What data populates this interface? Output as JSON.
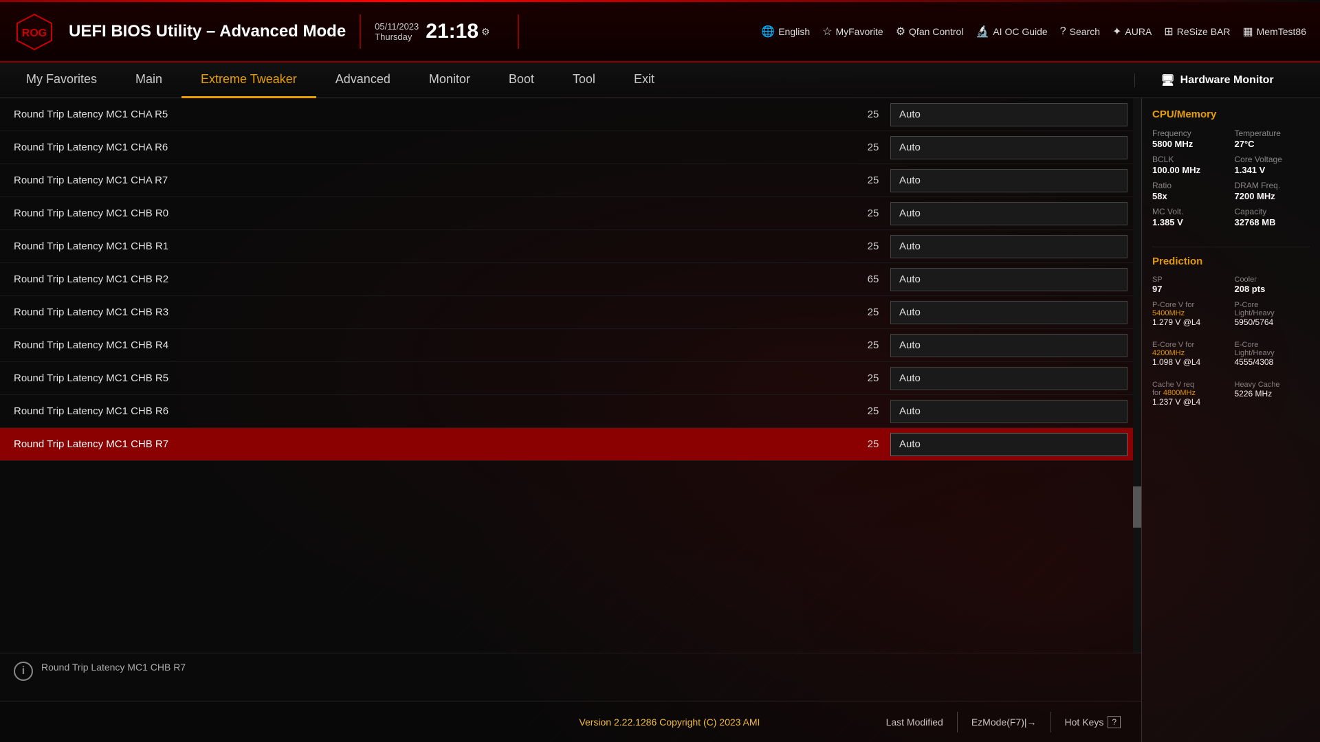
{
  "header": {
    "title": "UEFI BIOS Utility – Advanced Mode",
    "date": "05/11/2023",
    "day": "Thursday",
    "time": "21:18",
    "tools": [
      {
        "id": "english",
        "label": "English",
        "icon": "🌐"
      },
      {
        "id": "myfavorite",
        "label": "MyFavorite",
        "icon": "☆"
      },
      {
        "id": "qfan",
        "label": "Qfan Control",
        "icon": "⚙"
      },
      {
        "id": "aioc",
        "label": "AI OC Guide",
        "icon": "🔬"
      },
      {
        "id": "search",
        "label": "Search",
        "icon": "?"
      },
      {
        "id": "aura",
        "label": "AURA",
        "icon": "✦"
      },
      {
        "id": "resizebar",
        "label": "ReSize BAR",
        "icon": "⊞"
      },
      {
        "id": "memtest",
        "label": "MemTest86",
        "icon": "▦"
      }
    ]
  },
  "navbar": {
    "items": [
      {
        "id": "favorites",
        "label": "My Favorites"
      },
      {
        "id": "main",
        "label": "Main"
      },
      {
        "id": "extreme-tweaker",
        "label": "Extreme Tweaker",
        "active": true
      },
      {
        "id": "advanced",
        "label": "Advanced"
      },
      {
        "id": "monitor",
        "label": "Monitor"
      },
      {
        "id": "boot",
        "label": "Boot"
      },
      {
        "id": "tool",
        "label": "Tool"
      },
      {
        "id": "exit",
        "label": "Exit"
      }
    ]
  },
  "settings": {
    "rows": [
      {
        "name": "Round Trip Latency MC1 CHA R5",
        "value": "25",
        "dropdown": "Auto",
        "selected": false
      },
      {
        "name": "Round Trip Latency MC1 CHA R6",
        "value": "25",
        "dropdown": "Auto",
        "selected": false
      },
      {
        "name": "Round Trip Latency MC1 CHA R7",
        "value": "25",
        "dropdown": "Auto",
        "selected": false
      },
      {
        "name": "Round Trip Latency MC1 CHB R0",
        "value": "25",
        "dropdown": "Auto",
        "selected": false
      },
      {
        "name": "Round Trip Latency MC1 CHB R1",
        "value": "25",
        "dropdown": "Auto",
        "selected": false
      },
      {
        "name": "Round Trip Latency MC1 CHB R2",
        "value": "65",
        "dropdown": "Auto",
        "selected": false
      },
      {
        "name": "Round Trip Latency MC1 CHB R3",
        "value": "25",
        "dropdown": "Auto",
        "selected": false
      },
      {
        "name": "Round Trip Latency MC1 CHB R4",
        "value": "25",
        "dropdown": "Auto",
        "selected": false
      },
      {
        "name": "Round Trip Latency MC1 CHB R5",
        "value": "25",
        "dropdown": "Auto",
        "selected": false
      },
      {
        "name": "Round Trip Latency MC1 CHB R6",
        "value": "25",
        "dropdown": "Auto",
        "selected": false
      },
      {
        "name": "Round Trip Latency MC1 CHB R7",
        "value": "25",
        "dropdown": "Auto",
        "selected": true
      }
    ],
    "info_text": "Round Trip Latency MC1 CHB R7"
  },
  "hw_monitor": {
    "title": "Hardware Monitor",
    "sections": {
      "cpu_memory": {
        "title": "CPU/Memory",
        "items": [
          {
            "label": "Frequency",
            "value": "5800 MHz"
          },
          {
            "label": "Temperature",
            "value": "27°C"
          },
          {
            "label": "BCLK",
            "value": "100.00 MHz"
          },
          {
            "label": "Core Voltage",
            "value": "1.341 V"
          },
          {
            "label": "Ratio",
            "value": "58x"
          },
          {
            "label": "DRAM Freq.",
            "value": "7200 MHz"
          },
          {
            "label": "MC Volt.",
            "value": "1.385 V"
          },
          {
            "label": "Capacity",
            "value": "32768 MB"
          }
        ]
      },
      "prediction": {
        "title": "Prediction",
        "sp_label": "SP",
        "sp_value": "97",
        "cooler_label": "Cooler",
        "cooler_value": "208 pts",
        "pcore_label": "P-Core V for",
        "pcore_freq": "5400MHz",
        "pcore_v": "1.279 V @L4",
        "pcore_lh_label": "P-Core\nLight/Heavy",
        "pcore_lh_value": "5950/5764",
        "ecore_label": "E-Core V for",
        "ecore_freq": "4200MHz",
        "ecore_v": "1.098 V @L4",
        "ecore_lh_label": "E-Core\nLight/Heavy",
        "ecore_lh_value": "4555/4308",
        "cache_label": "Cache V req\nfor",
        "cache_freq": "4800MHz",
        "cache_v": "1.237 V @L4",
        "heavy_cache_label": "Heavy Cache",
        "heavy_cache_value": "5226 MHz"
      }
    }
  },
  "footer": {
    "version": "Version 2.22.1286 Copyright (C) 2023 AMI",
    "last_modified": "Last Modified",
    "ez_mode": "EzMode(F7)|→",
    "hot_keys": "Hot Keys"
  }
}
